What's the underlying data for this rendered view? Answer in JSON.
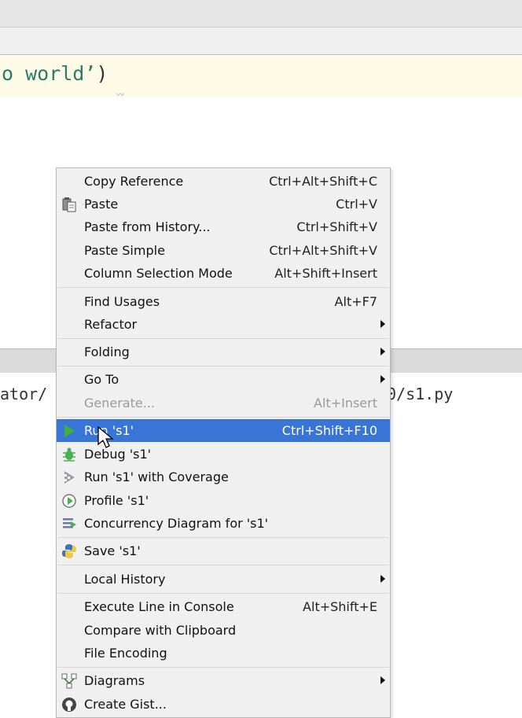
{
  "editor": {
    "code_text": "o world’",
    "code_paren": ")"
  },
  "console": {
    "left_text": "ator/",
    "right_text": "0/s1.py"
  },
  "menu": {
    "copy_reference": {
      "label": "Copy Reference",
      "shortcut": "Ctrl+Alt+Shift+C"
    },
    "paste": {
      "label": "Paste",
      "shortcut": "Ctrl+V",
      "icon": "paste-icon"
    },
    "paste_from_history": {
      "label": "Paste from History...",
      "shortcut": "Ctrl+Shift+V"
    },
    "paste_simple": {
      "label": "Paste Simple",
      "shortcut": "Ctrl+Alt+Shift+V"
    },
    "column_selection_mode": {
      "label": "Column Selection Mode",
      "shortcut": "Alt+Shift+Insert"
    },
    "find_usages": {
      "label": "Find Usages",
      "shortcut": "Alt+F7"
    },
    "refactor": {
      "label": "Refactor"
    },
    "folding": {
      "label": "Folding"
    },
    "go_to": {
      "label": "Go To"
    },
    "generate": {
      "label": "Generate...",
      "shortcut": "Alt+Insert",
      "disabled": true
    },
    "run": {
      "label": "Run 's1'",
      "shortcut": "Ctrl+Shift+F10",
      "icon": "run-icon",
      "selected": true
    },
    "debug": {
      "label": "Debug 's1'",
      "icon": "debug-icon"
    },
    "run_coverage": {
      "label": "Run 's1' with Coverage",
      "icon": "coverage-icon"
    },
    "profile": {
      "label": "Profile 's1'",
      "icon": "profile-icon"
    },
    "concurrency": {
      "label": "Concurrency Diagram for  's1'",
      "icon": "concurrency-icon"
    },
    "save": {
      "label": "Save 's1'",
      "icon": "python-icon"
    },
    "local_history": {
      "label": "Local History"
    },
    "execute_line": {
      "label": "Execute Line in Console",
      "shortcut": "Alt+Shift+E"
    },
    "compare_clipboard": {
      "label": "Compare with Clipboard"
    },
    "file_encoding": {
      "label": "File Encoding"
    },
    "diagrams": {
      "label": "Diagrams",
      "icon": "diagrams-icon"
    },
    "create_gist": {
      "label": "Create Gist...",
      "icon": "github-icon"
    }
  },
  "colors": {
    "selection": "#3875d7",
    "menu_bg": "#f0f0f0",
    "code_green": "#2f7a6b"
  }
}
